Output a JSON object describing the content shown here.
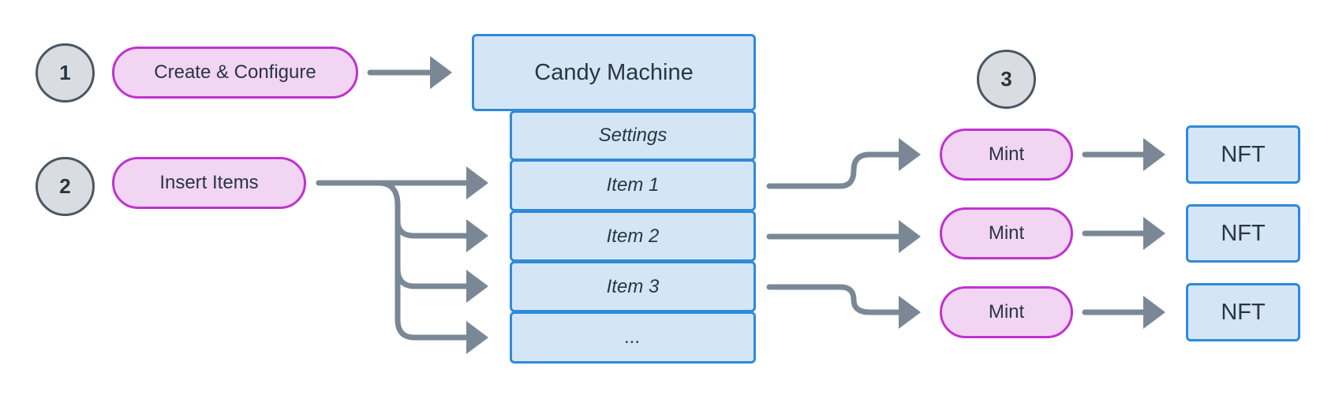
{
  "steps": [
    "1",
    "2",
    "3"
  ],
  "actions": {
    "create": "Create & Configure",
    "insert": "Insert Items",
    "mint": "Mint"
  },
  "candy_machine": {
    "title": "Candy Machine",
    "rows": [
      "Settings",
      "Item 1",
      "Item 2",
      "Item 3",
      "..."
    ]
  },
  "output": "NFT",
  "colors": {
    "pill_fill": "#f1d5f3",
    "pill_stroke": "#c032d0",
    "box_fill": "#d4e6f6",
    "box_stroke": "#2f8ad8",
    "arrow": "#7a8896",
    "step_fill": "#d9dde1",
    "step_stroke": "#4a5763"
  }
}
